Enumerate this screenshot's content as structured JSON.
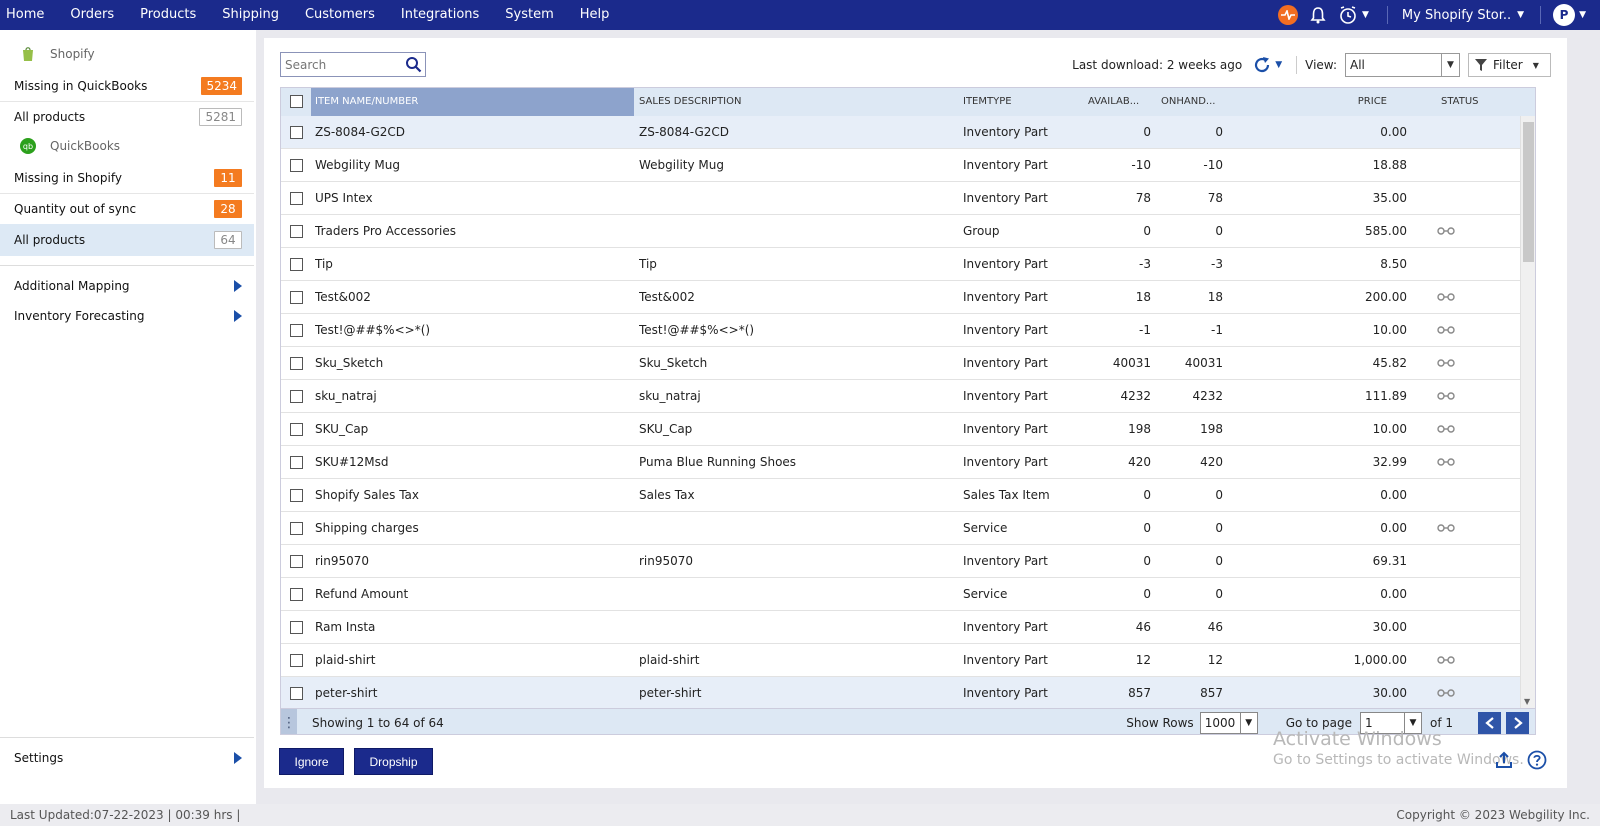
{
  "nav": {
    "items": [
      "Home",
      "Orders",
      "Products",
      "Shipping",
      "Customers",
      "Integrations",
      "System",
      "Help"
    ],
    "store": "My Shopify Stor..",
    "avatar": "P"
  },
  "sidebar": {
    "shopify_header": "Shopify",
    "quickbooks_header": "QuickBooks",
    "missing_in_qb": {
      "label": "Missing in QuickBooks",
      "count": "5234"
    },
    "all_products_shopify": {
      "label": "All products",
      "count": "5281"
    },
    "missing_in_shopify": {
      "label": "Missing in Shopify",
      "count": "11"
    },
    "qty_out_of_sync": {
      "label": "Quantity out of sync",
      "count": "28"
    },
    "all_products_qb": {
      "label": "All products",
      "count": "64"
    },
    "additional_mapping": "Additional Mapping",
    "inventory_forecasting": "Inventory Forecasting",
    "settings": "Settings"
  },
  "toolbar": {
    "search_placeholder": "Search",
    "last_download": "Last download: 2 weeks ago",
    "view_label": "View:",
    "view_value": "All",
    "filter_label": "Filter"
  },
  "table": {
    "headers": {
      "name": "ITEM NAME/NUMBER",
      "desc": "SALES DESCRIPTION",
      "type": "ITEMTYPE",
      "avail": "AVAILAB...",
      "onhand": "ONHAND...",
      "price": "PRICE",
      "status": "STATUS"
    },
    "rows": [
      {
        "name": "ZS-8084-G2CD",
        "desc": "ZS-8084-G2CD",
        "type": "Inventory Part",
        "avail": "0",
        "onhand": "0",
        "price": "0.00",
        "linked": false
      },
      {
        "name": "Webgility Mug",
        "desc": "Webgility Mug",
        "type": "Inventory Part",
        "avail": "-10",
        "onhand": "-10",
        "price": "18.88",
        "linked": false
      },
      {
        "name": "UPS Intex",
        "desc": "",
        "type": "Inventory Part",
        "avail": "78",
        "onhand": "78",
        "price": "35.00",
        "linked": false
      },
      {
        "name": "Traders Pro Accessories",
        "desc": "",
        "type": "Group",
        "avail": "0",
        "onhand": "0",
        "price": "585.00",
        "linked": true
      },
      {
        "name": "Tip",
        "desc": "Tip",
        "type": "Inventory Part",
        "avail": "-3",
        "onhand": "-3",
        "price": "8.50",
        "linked": false
      },
      {
        "name": "Test&002",
        "desc": "Test&002",
        "type": "Inventory Part",
        "avail": "18",
        "onhand": "18",
        "price": "200.00",
        "linked": true
      },
      {
        "name": "Test!@##$%<>*()",
        "desc": "Test!@##$%<>*()",
        "type": "Inventory Part",
        "avail": "-1",
        "onhand": "-1",
        "price": "10.00",
        "linked": true
      },
      {
        "name": "Sku_Sketch",
        "desc": "Sku_Sketch",
        "type": "Inventory Part",
        "avail": "40031",
        "onhand": "40031",
        "price": "45.82",
        "linked": true
      },
      {
        "name": "sku_natraj",
        "desc": "sku_natraj",
        "type": "Inventory Part",
        "avail": "4232",
        "onhand": "4232",
        "price": "111.89",
        "linked": true
      },
      {
        "name": "SKU_Cap",
        "desc": "SKU_Cap",
        "type": "Inventory Part",
        "avail": "198",
        "onhand": "198",
        "price": "10.00",
        "linked": true
      },
      {
        "name": "SKU#12Msd",
        "desc": "Puma Blue Running Shoes",
        "type": "Inventory Part",
        "avail": "420",
        "onhand": "420",
        "price": "32.99",
        "linked": true
      },
      {
        "name": "Shopify Sales Tax",
        "desc": "Sales Tax",
        "type": "Sales Tax Item",
        "avail": "0",
        "onhand": "0",
        "price": "0.00",
        "linked": false
      },
      {
        "name": "Shipping charges",
        "desc": "",
        "type": "Service",
        "avail": "0",
        "onhand": "0",
        "price": "0.00",
        "linked": true
      },
      {
        "name": "rin95070",
        "desc": "rin95070",
        "type": "Inventory Part",
        "avail": "0",
        "onhand": "0",
        "price": "69.31",
        "linked": false
      },
      {
        "name": "Refund Amount",
        "desc": "",
        "type": "Service",
        "avail": "0",
        "onhand": "0",
        "price": "0.00",
        "linked": false
      },
      {
        "name": "Ram Insta",
        "desc": "",
        "type": "Inventory Part",
        "avail": "46",
        "onhand": "46",
        "price": "30.00",
        "linked": false
      },
      {
        "name": "plaid-shirt",
        "desc": "plaid-shirt",
        "type": "Inventory Part",
        "avail": "12",
        "onhand": "12",
        "price": "1,000.00",
        "linked": true
      },
      {
        "name": "peter-shirt",
        "desc": "peter-shirt",
        "type": "Inventory Part",
        "avail": "857",
        "onhand": "857",
        "price": "30.00",
        "linked": true
      }
    ]
  },
  "footer": {
    "showing": "Showing 1 to 64 of 64",
    "show_rows_label": "Show Rows",
    "show_rows_value": "1000",
    "goto_label": "Go to page",
    "page_value": "1",
    "of_pages": "of 1"
  },
  "actions": {
    "ignore": "Ignore",
    "dropship": "Dropship"
  },
  "watermark": {
    "line1": "Activate Windows",
    "line2": "Go to Settings to activate Windows."
  },
  "statusbar": {
    "last_updated": "Last Updated:07-22-2023 | 00:39 hrs |",
    "copyright": "Copyright © 2023 Webgility Inc."
  },
  "colors": {
    "nav_bg": "#1b2a8c",
    "badge_orange": "#f47b20",
    "active_bg": "#dde9f5"
  }
}
